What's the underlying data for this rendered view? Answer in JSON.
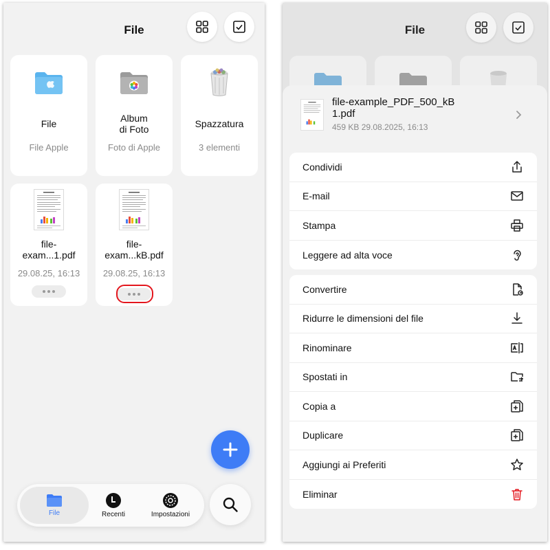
{
  "left": {
    "title": "File",
    "cards": [
      {
        "name": "File",
        "sub": "File Apple"
      },
      {
        "name": "Album\ndi Foto",
        "sub": "Foto di Apple"
      },
      {
        "name": "Spazzatura",
        "sub": "3 elementi"
      }
    ],
    "files": [
      {
        "name": "file-\nexam...1.pdf",
        "date": "29.08.25, 16:13"
      },
      {
        "name": "file-\nexam...kB.pdf",
        "date": "29.08.25, 16:13"
      }
    ],
    "tabs": [
      {
        "label": "File",
        "active": true
      },
      {
        "label": "Recenti",
        "active": false
      },
      {
        "label": "Impostazioni",
        "active": false
      }
    ]
  },
  "right": {
    "title": "File",
    "sheet": {
      "file_name": "file-example_PDF_500_kB\n1.pdf",
      "file_meta": "459 KB 29.08.2025, 16:13",
      "group1": [
        "Condividi",
        "E-mail",
        "Stampa",
        "Leggere ad alta voce"
      ],
      "group2": [
        "Convertire",
        "Ridurre le dimensioni del file",
        "Rinominare",
        "Spostati in",
        "Copia a",
        "Duplicare",
        "Aggiungi ai Preferiti",
        "Eliminar"
      ]
    }
  },
  "colors": {
    "accent": "#3e7cf6",
    "danger": "#e3161d",
    "folder": "#5ab4ee"
  }
}
